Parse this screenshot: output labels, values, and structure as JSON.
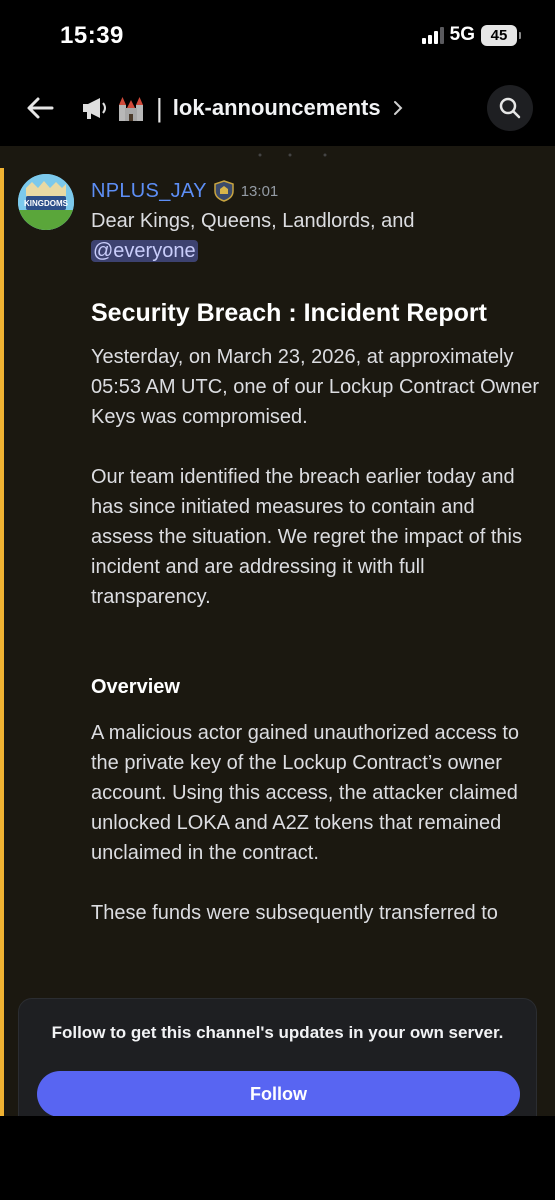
{
  "status_bar": {
    "time": "15:39",
    "network": "5G",
    "battery": "45"
  },
  "header": {
    "channel_name": "lok-announcements",
    "icons": [
      "back-arrow-icon",
      "megaphone-icon",
      "castle-icon",
      "chevron-right-icon",
      "search-icon"
    ]
  },
  "message": {
    "author": "NPLUS_JAY",
    "timestamp": "13:01",
    "avatar_text": "KINGDOMS",
    "greeting": "Dear Kings, Queens, Landlords, and",
    "mention": "@everyone",
    "title": "Security Breach : Incident Report",
    "paragraph1": "Yesterday, on March 23, 2026, at approximately 05:53 AM UTC, one of our Lockup Contract Owner Keys was compromised.",
    "paragraph2": "Our team identified the breach earlier today and has since initiated measures to contain and assess the situation. We regret the impact of this incident and are addressing it with full transparency.",
    "overview_heading": "Overview",
    "paragraph3": "A malicious actor gained unauthorized access to the private key of the Lockup Contract’s owner account. Using this access, the attacker claimed unlocked LOKA and A2Z tokens that remained unclaimed in the contract.",
    "paragraph4": "These funds were subsequently transferred to"
  },
  "follow_popup": {
    "text": "Follow to get this channel's updates in your own server.",
    "button_label": "Follow"
  },
  "colors": {
    "accent": "#5865f2",
    "username": "#5d8ef5",
    "highlight_bar": "#f0b232",
    "message_bg": "#1b1810",
    "mention_bg": "#3d4270"
  }
}
